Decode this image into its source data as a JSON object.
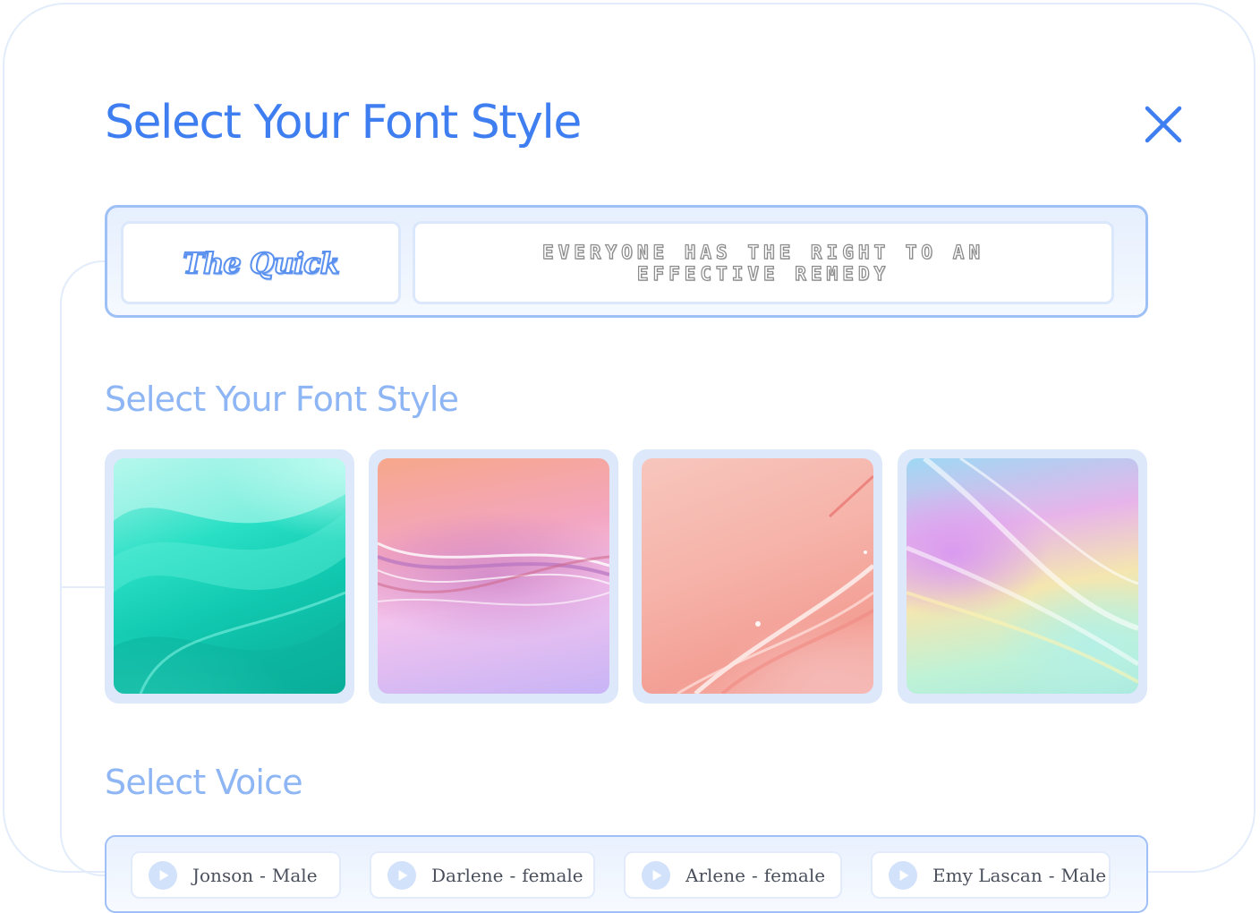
{
  "dialog": {
    "title": "Select Your Font Style",
    "close_icon": "close-icon"
  },
  "font_samples": [
    {
      "text": "The Quick"
    },
    {
      "text": "EVERYONE HAS THE RIGHT TO AN EFFECTIVE REMEDY"
    }
  ],
  "backgrounds": {
    "label": "Select Your Font Style",
    "tiles": [
      {
        "theme": "teal waves"
      },
      {
        "theme": "pink purple silk"
      },
      {
        "theme": "peach coral"
      },
      {
        "theme": "holographic pastel"
      }
    ]
  },
  "voices": {
    "label": "Select Voice",
    "separator": "-",
    "play_icon": "play-icon",
    "items": [
      {
        "name": "Jonson",
        "gender": "Male"
      },
      {
        "name": "Darlene",
        "gender": "female"
      },
      {
        "name": "Arlene",
        "gender": "female"
      },
      {
        "name": "Emy Lascan",
        "gender": "Male"
      }
    ]
  },
  "colors": {
    "accent": "#3f7ef0",
    "accent_light": "#8fb6f4",
    "panel_border": "#9fc0f6",
    "tile_frame": "#dde8fb"
  }
}
